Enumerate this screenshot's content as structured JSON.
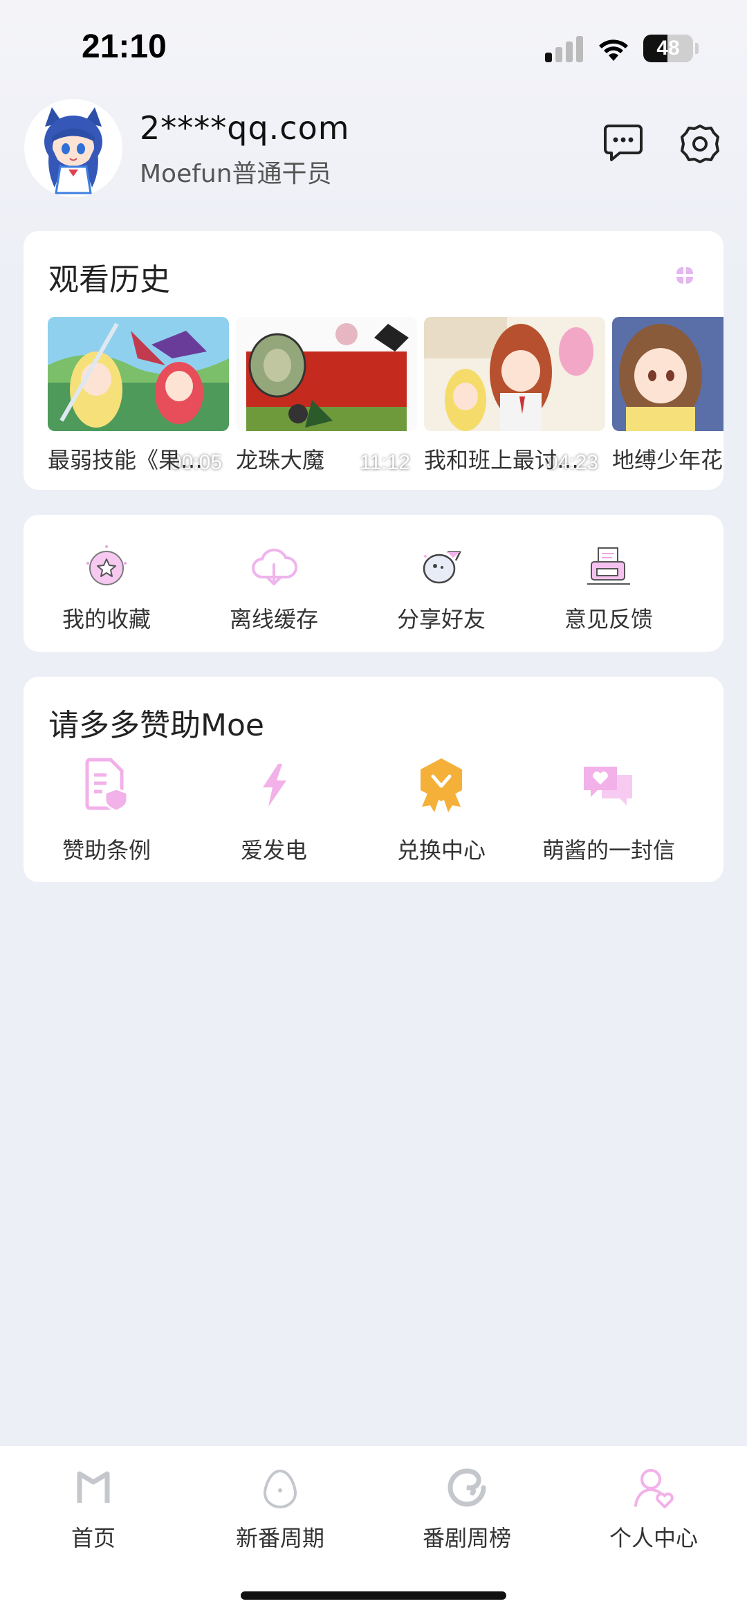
{
  "status_bar": {
    "time": "21:10",
    "battery": "48",
    "battery_level": 0.48
  },
  "profile": {
    "username": "2****qq.com",
    "level": "Moefun普通干员"
  },
  "history": {
    "title": "观看历史",
    "items": [
      {
        "name": "最弱技能《果…",
        "duration": "00:05"
      },
      {
        "name": "龙珠大魔",
        "duration": "11:12"
      },
      {
        "name": "我和班上最讨…",
        "duration": "04:23"
      },
      {
        "name": "地缚少年花",
        "duration": ""
      }
    ]
  },
  "actions": [
    {
      "label": "我的收藏",
      "icon": "star-badge-icon"
    },
    {
      "label": "离线缓存",
      "icon": "cloud-download-icon"
    },
    {
      "label": "分享好友",
      "icon": "share-planet-icon"
    },
    {
      "label": "意见反馈",
      "icon": "feedback-printer-icon"
    }
  ],
  "sponsor": {
    "title": "请多多赞助Moe",
    "items": [
      {
        "label": "赞助条例",
        "icon": "document-shield-icon"
      },
      {
        "label": "爱发电",
        "icon": "lightning-icon"
      },
      {
        "label": "兑换中心",
        "icon": "ribbon-badge-icon"
      },
      {
        "label": "萌酱的一封信",
        "icon": "heart-chat-icon"
      }
    ]
  },
  "nav": [
    {
      "label": "首页",
      "icon": "home-m-icon"
    },
    {
      "label": "新番周期",
      "icon": "egg-icon"
    },
    {
      "label": "番剧周榜",
      "icon": "swirl-icon"
    },
    {
      "label": "个人中心",
      "icon": "person-heart-icon"
    }
  ],
  "colors": {
    "accent_pink": "#e9a6e6",
    "accent_orange": "#f5b03a",
    "background": "#eceff6"
  }
}
